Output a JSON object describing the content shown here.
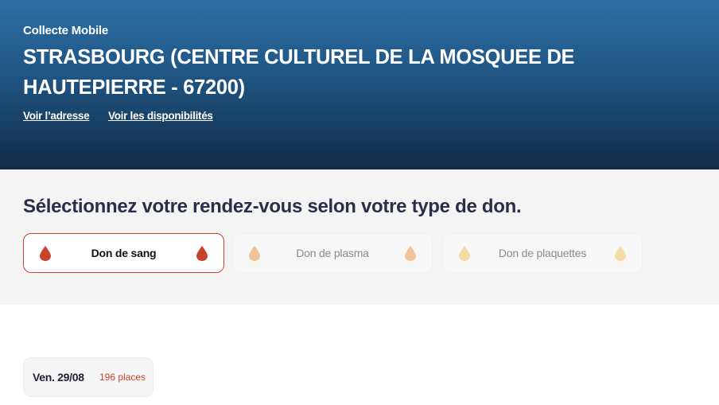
{
  "header": {
    "kicker": "Collecte Mobile",
    "title": "STRASBOURG (CENTRE CULTUREL DE LA MOSQUEE DE HAUTEPIERRE - 67200)",
    "link_address": "Voir l’adresse",
    "link_availability": "Voir les disponibilités"
  },
  "selection": {
    "heading": "Sélectionnez votre rendez-vous selon votre type de don.",
    "tabs": [
      {
        "label": "Don de sang",
        "active": true,
        "icon": "blood-drop-icon",
        "color": "#c9432c"
      },
      {
        "label": "Don de plasma",
        "active": false,
        "icon": "plasma-drop-icon",
        "color": "#f0c39a"
      },
      {
        "label": "Don de plaquettes",
        "active": false,
        "icon": "platelet-drop-icon",
        "color": "#f5dca6"
      }
    ]
  },
  "dates": [
    {
      "label": "Ven. 29/08",
      "places": "196 places"
    }
  ],
  "colors": {
    "accent": "#c9432c",
    "heading": "#2b2e4a",
    "hero_top": "#2c6ea5",
    "hero_bottom": "#112b45"
  }
}
